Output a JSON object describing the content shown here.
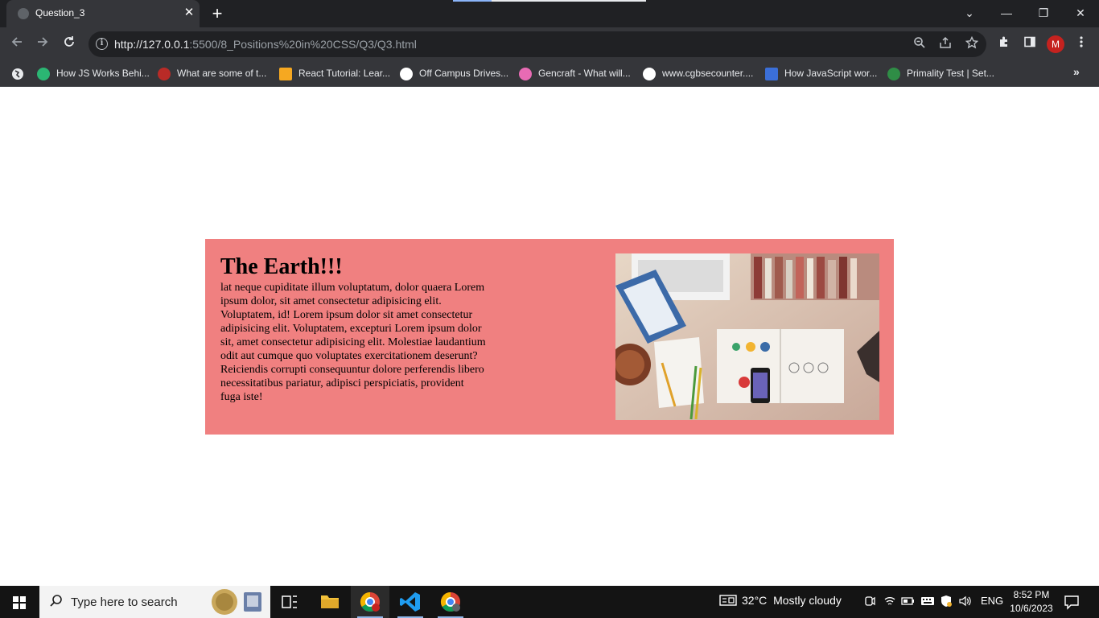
{
  "browser": {
    "tab_title": "Question_3",
    "tab_close": "✕",
    "new_tab": "+",
    "url_host": "http://127.0.0.1",
    "url_path": ":5500/8_Positions%20in%20CSS/Q3/Q3.html",
    "profile_initial": "M",
    "window_buttons": {
      "chevron": "⌄",
      "minimize": "—",
      "restore": "❐",
      "close": "✕"
    },
    "bookmarks": [
      {
        "label": "How JS Works Behi...",
        "color": "#2bb673"
      },
      {
        "label": "What are some of t...",
        "color": "#b92b27"
      },
      {
        "label": "React Tutorial: Lear...",
        "color": "#f6a821"
      },
      {
        "label": "Off Campus Drives...",
        "color": "#ffffff"
      },
      {
        "label": "Gencraft - What will...",
        "color": "#e86bb4"
      },
      {
        "label": "www.cgbsecounter....",
        "color": "#ffffff"
      },
      {
        "label": "How JavaScript wor...",
        "color": "#3b6fd8"
      },
      {
        "label": "Primality Test | Set...",
        "color": "#2f8d46"
      }
    ],
    "bookmarks_overflow": "»"
  },
  "page": {
    "background": "#ffffff",
    "card_color": "#f08080",
    "title": "The Earth!!!",
    "body": "lat neque cupiditate illum voluptatum, dolor quaera Lorem ipsum dolor, sit amet consectetur adipisicing elit. Voluptatem, id! Lorem ipsum dolor sit amet consectetur adipisicing elit. Voluptatem, excepturi Lorem ipsum dolor sit, amet consectetur adipisicing elit. Molestiae laudantium odit aut cumque quo voluptates exercitationem deserunt? Reiciendis corrupti consequuntur dolore perferendis libero necessitatibus pariatur, adipisci perspiciatis, provident fuga iste!"
  },
  "taskbar": {
    "search_placeholder": "Type here to search",
    "weather_temp": "32°C",
    "weather_text": "Mostly cloudy",
    "language": "ENG",
    "time": "8:52 PM",
    "date": "10/6/2023"
  }
}
